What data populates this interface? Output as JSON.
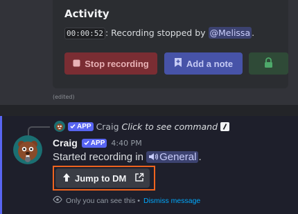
{
  "embed": {
    "title": "Activity",
    "timestamp_code": "00:00:52",
    "line_text": ": Recording stopped by ",
    "mention": "@Melissa",
    "line_end": ".",
    "buttons": {
      "stop": "Stop recording",
      "note": "Add a note"
    }
  },
  "edited": "(edited)",
  "reply": {
    "app_tag": "APP",
    "name": "Craig",
    "command_text": "Click to see command"
  },
  "message": {
    "author": "Craig",
    "app_tag": "APP",
    "time": "4:40 PM",
    "text": "Started recording in ",
    "channel": "General",
    "end": ".",
    "jump_button": "Jump to DM"
  },
  "ephemeral": {
    "text": "Only you can see this • ",
    "dismiss": "Dismiss message"
  },
  "colors": {
    "accent": "#5865f2",
    "highlight": "#f0641e",
    "danger_button": "#7a2d33",
    "primary_button": "#4753a8",
    "success_button": "#2f4a37"
  },
  "icons": [
    "stop-square-icon",
    "bookmark-plus-icon",
    "lock-icon",
    "check-icon",
    "slash-command-icon",
    "speaker-icon",
    "arrow-up-icon",
    "external-link-icon",
    "eye-icon"
  ]
}
